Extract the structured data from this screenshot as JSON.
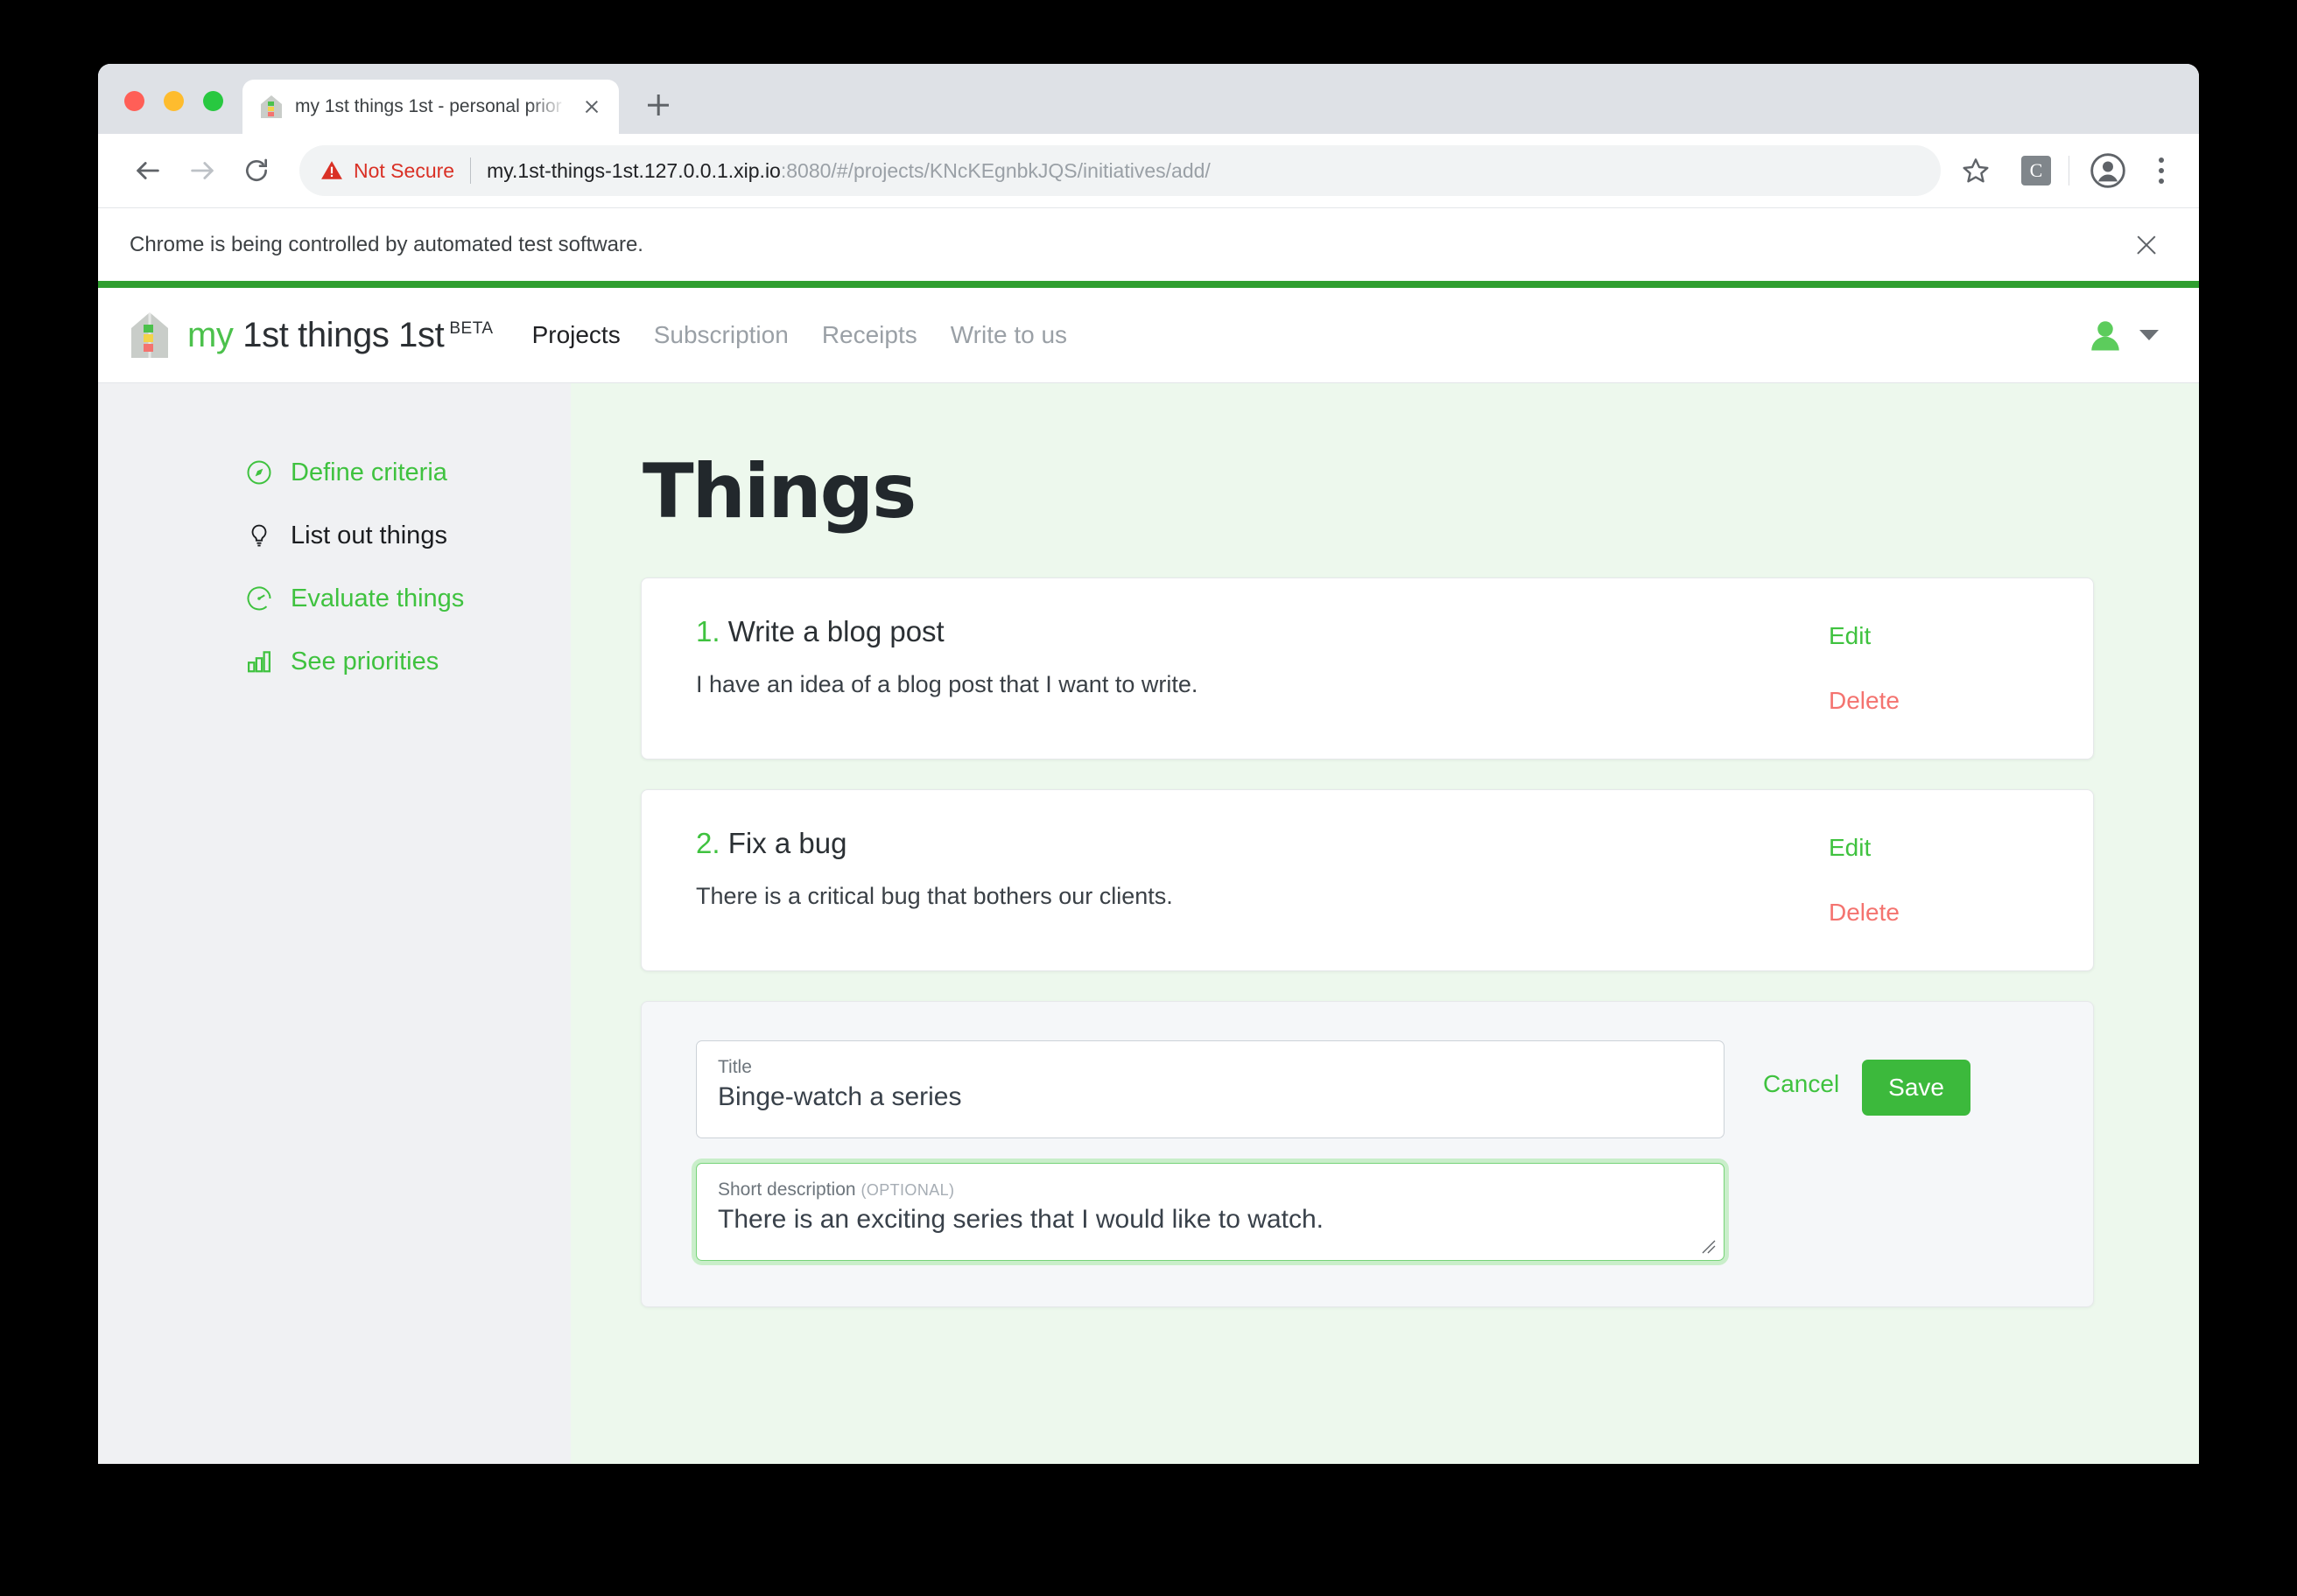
{
  "browser": {
    "tab": {
      "title": "my 1st things 1st - personal prior",
      "favicon": "house-icon"
    },
    "security_label": "Not Secure",
    "url_host": "my.1st-things-1st.127.0.0.1.xip.io",
    "url_rest": ":8080/#/projects/KNcKEgnbkJQS/initiatives/add/",
    "extension_badge": "C",
    "infobar_text": "Chrome is being controlled by automated test software."
  },
  "app": {
    "brand": {
      "my": "my",
      "rest": " 1st things 1st",
      "beta": "BETA"
    },
    "nav": [
      {
        "label": "Projects",
        "active": true
      },
      {
        "label": "Subscription",
        "active": false
      },
      {
        "label": "Receipts",
        "active": false
      },
      {
        "label": "Write to us",
        "active": false
      }
    ],
    "sidebar": [
      {
        "label": "Define criteria",
        "icon": "compass-icon",
        "current": false
      },
      {
        "label": "List out things",
        "icon": "lightbulb-icon",
        "current": true
      },
      {
        "label": "Evaluate things",
        "icon": "gauge-icon",
        "current": false
      },
      {
        "label": "See priorities",
        "icon": "bar-chart-icon",
        "current": false
      }
    ],
    "page_title": "Things",
    "items": [
      {
        "num": "1.",
        "title": "Write a blog post",
        "desc": "I have an idea of a blog post that I want to write.",
        "edit": "Edit",
        "delete": "Delete"
      },
      {
        "num": "2.",
        "title": "Fix a bug",
        "desc": "There is a critical bug that bothers our clients.",
        "edit": "Edit",
        "delete": "Delete"
      }
    ],
    "form": {
      "title_label": "Title",
      "title_value": "Binge-watch a series",
      "desc_label": "Short description",
      "desc_optional": "(OPTIONAL)",
      "desc_value": "There is an exciting series that I would like to watch.",
      "cancel_label": "Cancel",
      "save_label": "Save"
    },
    "colors": {
      "green": "#3fc23f",
      "save_green": "#3cb93c",
      "delete_red": "#f4736f",
      "page_bg": "#edf8ed",
      "title_dark": "#22282c"
    }
  }
}
